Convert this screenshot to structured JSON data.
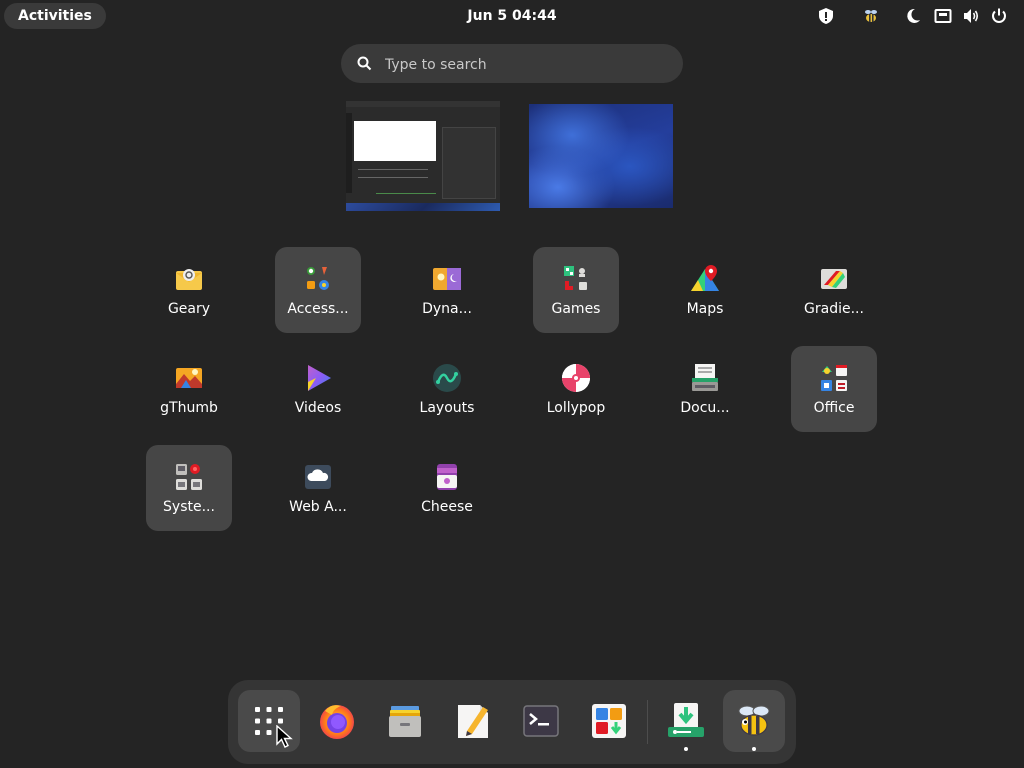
{
  "topbar": {
    "activities_label": "Activities",
    "clock": "Jun 5  04:44",
    "tray_icons": [
      "shield-icon",
      "bee-icon",
      "moon-icon",
      "network-icon",
      "volume-icon",
      "power-icon"
    ]
  },
  "search": {
    "placeholder": "Type to search"
  },
  "workspaces": [
    "workspace-1",
    "workspace-2"
  ],
  "apps": [
    {
      "label": "Geary",
      "icon": "mail-icon",
      "folder": false
    },
    {
      "label": "Access...",
      "icon": "accessories-folder-icon",
      "folder": true
    },
    {
      "label": "Dyna...",
      "icon": "dynamic-wallpaper-icon",
      "folder": false
    },
    {
      "label": "Games",
      "icon": "games-folder-icon",
      "folder": true
    },
    {
      "label": "Maps",
      "icon": "maps-icon",
      "folder": false
    },
    {
      "label": "Gradie...",
      "icon": "gradience-icon",
      "folder": false
    },
    {
      "label": "gThumb",
      "icon": "gthumb-icon",
      "folder": false
    },
    {
      "label": "Videos",
      "icon": "videos-icon",
      "folder": false
    },
    {
      "label": "Layouts",
      "icon": "layouts-icon",
      "folder": false
    },
    {
      "label": "Lollypop",
      "icon": "lollypop-icon",
      "folder": false
    },
    {
      "label": "Docu...",
      "icon": "document-scanner-icon",
      "folder": false
    },
    {
      "label": "Office",
      "icon": "office-folder-icon",
      "folder": true
    },
    {
      "label": "Syste...",
      "icon": "system-folder-icon",
      "folder": true
    },
    {
      "label": "Web A...",
      "icon": "web-apps-icon",
      "folder": false
    },
    {
      "label": "Cheese",
      "icon": "cheese-icon",
      "folder": false
    }
  ],
  "dash": {
    "items": [
      {
        "icon": "app-grid-icon",
        "active": true
      },
      {
        "icon": "firefox-icon",
        "active": false
      },
      {
        "icon": "files-icon",
        "active": false
      },
      {
        "icon": "text-editor-icon",
        "active": false
      },
      {
        "icon": "terminal-icon",
        "active": false
      },
      {
        "icon": "software-icon",
        "active": false
      },
      {
        "icon": "warehouse-icon",
        "active": false
      },
      {
        "icon": "bee-app-icon",
        "active": true
      }
    ]
  },
  "colors": {
    "background": "#242424",
    "tile": "#464646",
    "dash": "#353535",
    "accent_blue": "#3584e4"
  }
}
